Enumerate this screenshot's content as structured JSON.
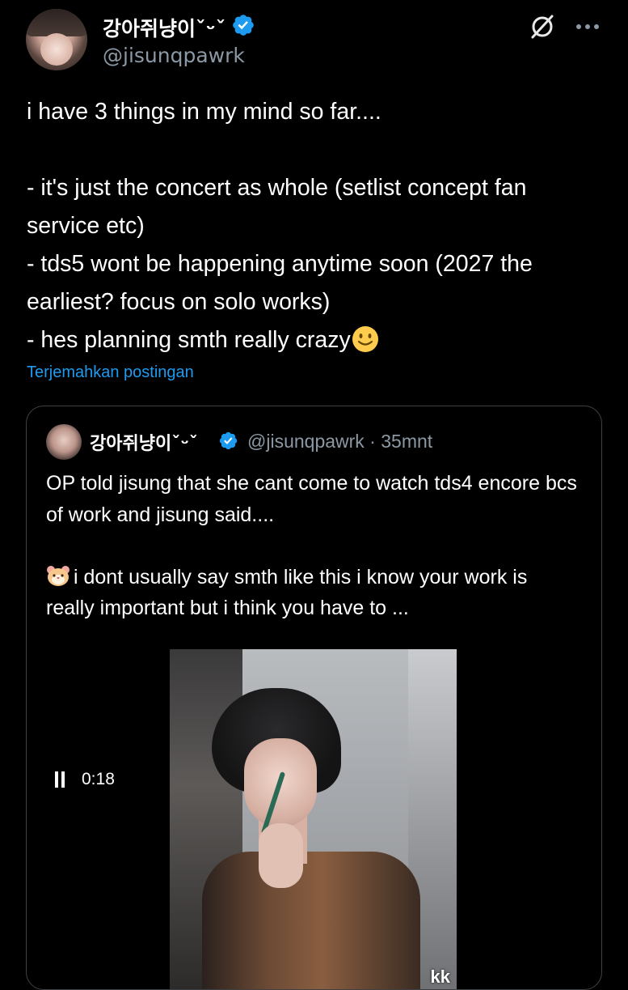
{
  "author": {
    "display_name": "강아쥐냥이ˇᵕˇ",
    "handle": "@jisunqpawrk",
    "verified": true
  },
  "icons": {
    "verified": "verified-badge-icon",
    "grok": "grok-icon",
    "more": "more-options-icon"
  },
  "colors": {
    "accent": "#1d9bf0",
    "text": "#ffffff",
    "muted": "#8b98a5",
    "background": "#000000",
    "border": "#3e4144"
  },
  "post": {
    "text": "i have 3 things in my mind so far....\n\n- it's just the concert as whole (setlist concept fan service etc)\n- tds5 wont be happening anytime soon (2027 the earliest? focus on solo works)\n- hes planning smth really crazy",
    "emoji": "slightly-smiling-face-emoji",
    "translate_label": "Terjemahkan postingan"
  },
  "quote": {
    "display_name": "강아쥐냥이ˇᵕˇ",
    "handle_time": "@jisunqpawrk · 35mnt",
    "text_line1": "OP told jisung that she cant come to watch tds4 encore bcs of work and jisung said....",
    "text_line2": "i dont usually say smth like this i know your work is really important but i think you have to ...",
    "emoji": "hamster-face-emoji",
    "media": {
      "overlay_text": "kk",
      "time": "0:18",
      "state": "playing"
    }
  }
}
